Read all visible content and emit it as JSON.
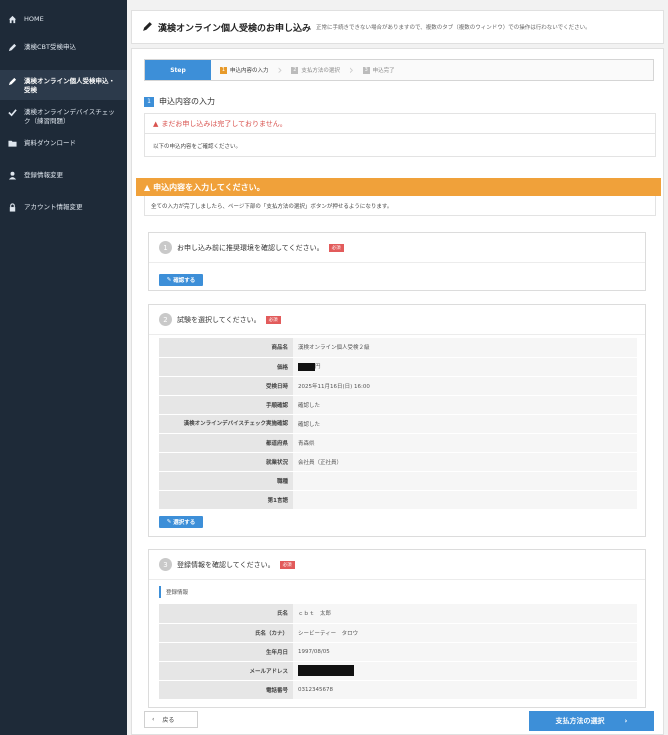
{
  "sidebar": {
    "items": [
      {
        "label": "HOME",
        "icon": "home-icon"
      },
      {
        "label": "漢検CBT受検申込",
        "icon": "pencil-icon"
      },
      {
        "label": "漢検オンライン個人受検申込・受検",
        "icon": "pencil-icon"
      },
      {
        "label": "漢検オンラインデバイスチェック（練習問題）",
        "icon": "check-icon"
      },
      {
        "label": "資料ダウンロード",
        "icon": "folder-icon"
      },
      {
        "label": "登録情報変更",
        "icon": "user-icon"
      },
      {
        "label": "アカウント情報変更",
        "icon": "lock-icon"
      }
    ]
  },
  "header": {
    "title": "漢検オンライン個人受検のお申し込み",
    "note": "正常に手続きできない場合がありますので、複数のタブ（複数のウィンドウ）での操作は行わないでください。"
  },
  "steps": {
    "label": "Step",
    "items": [
      {
        "num": "1",
        "label": "申込内容の入力"
      },
      {
        "num": "2",
        "label": "支払方法の選択"
      },
      {
        "num": "3",
        "label": "申込完了"
      }
    ]
  },
  "section": {
    "num": "1",
    "title": "申込内容の入力"
  },
  "alert": {
    "title": "まだお申し込みは完了しておりません。",
    "text": "以下の申込内容をご確認ください。"
  },
  "warning": {
    "title": "申込内容を入力してください。",
    "text": "全ての入力が完了しましたら、ページ下部の「支払方法の選択」ボタンが押せるようになります。"
  },
  "card1": {
    "num": "1",
    "title": "お申し込み前に推奨環境を確認してください。",
    "required": "必須",
    "button": "確認する"
  },
  "card2": {
    "num": "2",
    "title": "試験を選択してください。",
    "required": "必須",
    "button": "選択する",
    "rows": [
      {
        "key": "商品名",
        "value": "漢検オンライン個人受検２級"
      },
      {
        "key": "価格",
        "value": "円"
      },
      {
        "key": "受検日時",
        "value": "2025年11月16日(日) 16:00"
      },
      {
        "key": "手順確認",
        "value": "確認した"
      },
      {
        "key": "漢検オンラインデバイスチェック実施確認",
        "value": "確認した"
      },
      {
        "key": "都道府県",
        "value": "青森県"
      },
      {
        "key": "就業状況",
        "value": "会社員（正社員）"
      },
      {
        "key": "職種",
        "value": ""
      },
      {
        "key": "第1言語",
        "value": ""
      }
    ]
  },
  "card3": {
    "num": "3",
    "title": "登録情報を確認してください。",
    "required": "必須",
    "subhead": "登録情報",
    "rows": [
      {
        "key": "氏名",
        "value": "ｃｂｔ　太郎"
      },
      {
        "key": "氏名（カナ）",
        "value": "シービーティー　タロウ"
      },
      {
        "key": "生年月日",
        "value": "1997/08/05"
      },
      {
        "key": "メールアドレス",
        "value": ""
      },
      {
        "key": "電話番号",
        "value": "0312345678"
      }
    ]
  },
  "footer": {
    "back": "戻る",
    "next": "支払方法の選択"
  },
  "colors": {
    "sidebar": "#1e2a38",
    "accent": "#3d8fd8",
    "warning": "#f0a13a",
    "danger": "#d9534f"
  }
}
